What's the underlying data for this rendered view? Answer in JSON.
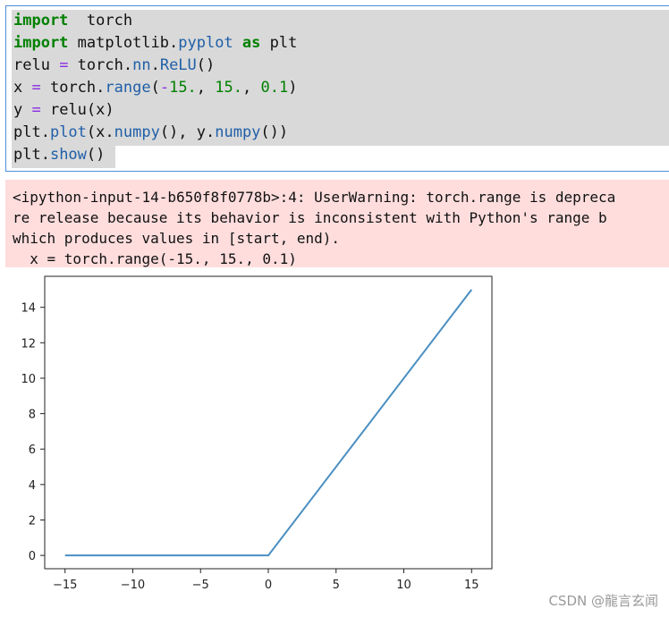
{
  "code": {
    "lines": [
      {
        "parts": [
          [
            "kw",
            "import"
          ],
          [
            "",
            "  torch"
          ]
        ]
      },
      {
        "parts": [
          [
            "kw",
            "import"
          ],
          [
            "",
            " matplotlib."
          ],
          [
            "fn",
            "pyplot"
          ],
          [
            "",
            " "
          ],
          [
            "kw",
            "as"
          ],
          [
            "",
            " plt"
          ]
        ]
      },
      {
        "parts": [
          [
            "",
            "relu "
          ],
          [
            "op",
            "="
          ],
          [
            "",
            " torch."
          ],
          [
            "fn",
            "nn"
          ],
          [
            "",
            "."
          ],
          [
            "fn",
            "ReLU"
          ],
          [
            "",
            "()"
          ]
        ]
      },
      {
        "parts": [
          [
            "",
            "x "
          ],
          [
            "op",
            "="
          ],
          [
            "",
            " torch."
          ],
          [
            "fn",
            "range"
          ],
          [
            "",
            "("
          ],
          [
            "op",
            "-"
          ],
          [
            "num",
            "15."
          ],
          [
            "",
            ", "
          ],
          [
            "num",
            "15."
          ],
          [
            "",
            ", "
          ],
          [
            "num",
            "0.1"
          ],
          [
            "",
            ")"
          ]
        ]
      },
      {
        "parts": [
          [
            "",
            "y "
          ],
          [
            "op",
            "="
          ],
          [
            "",
            " relu(x)"
          ]
        ]
      },
      {
        "parts": [
          [
            "",
            "plt."
          ],
          [
            "fn",
            "plot"
          ],
          [
            "",
            "(x."
          ],
          [
            "fn",
            "numpy"
          ],
          [
            "",
            "(), y."
          ],
          [
            "fn",
            "numpy"
          ],
          [
            "",
            "())"
          ]
        ]
      },
      {
        "parts": [
          [
            "",
            "plt."
          ],
          [
            "fn",
            "show"
          ],
          [
            "",
            "()"
          ]
        ]
      }
    ]
  },
  "warning": {
    "lines": [
      "<ipython-input-14-b650f8f0778b>:4: UserWarning: torch.range is depreca",
      "re release because its behavior is inconsistent with Python's range b",
      "which produces values in [start, end).",
      "  x = torch.range(-15., 15., 0.1)"
    ]
  },
  "chart_data": {
    "type": "line",
    "series": [
      {
        "x": [
          -15,
          0,
          15
        ],
        "y": [
          0,
          0,
          15
        ],
        "color": "#4a8fc1"
      }
    ],
    "xlim": [
      -16.5,
      16.5
    ],
    "ylim": [
      -0.75,
      15.75
    ],
    "xticks": [
      -15,
      -10,
      -5,
      0,
      5,
      10,
      15
    ],
    "xtick_labels": [
      "−15",
      "−10",
      "−5",
      "0",
      "5",
      "10",
      "15"
    ],
    "yticks": [
      0,
      2,
      4,
      6,
      8,
      10,
      12,
      14
    ],
    "ytick_labels": [
      "0",
      "2",
      "4",
      "6",
      "8",
      "10",
      "12",
      "14"
    ],
    "grid": false
  },
  "watermark": "CSDN @龍言玄闻"
}
